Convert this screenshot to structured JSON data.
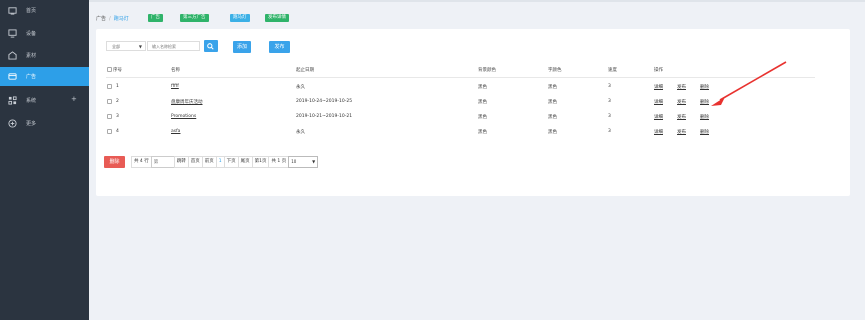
{
  "sidebar": {
    "items": [
      {
        "label": "首页",
        "icon": "home-icon"
      },
      {
        "label": "设备",
        "icon": "monitor-icon"
      },
      {
        "label": "素材",
        "icon": "image-icon"
      },
      {
        "label": "广告",
        "icon": "ad-icon"
      },
      {
        "label": "系统",
        "icon": "grid-icon"
      },
      {
        "label": "更多",
        "icon": "plus-circle-icon"
      }
    ],
    "active_index": 3,
    "accent": "#2d9fe8"
  },
  "breadcrumb": {
    "root": "广告",
    "separator": "/",
    "current": "跑马灯"
  },
  "tabs": [
    "广告",
    "第三方广告",
    "跑马灯",
    "发布详情"
  ],
  "filter": {
    "select_value": "全部",
    "search_placeholder": "输入名称检索",
    "add_label": "添加",
    "publish_label": "发布"
  },
  "table": {
    "headers": [
      "序号",
      "名称",
      "起止日期",
      "背景颜色",
      "字颜色",
      "速度",
      "操作"
    ],
    "rows": [
      {
        "index": "1",
        "name": "fffff",
        "dates": "永久",
        "bg_color": "黑色",
        "font_color": "黑色",
        "speed": "3",
        "actions": [
          "详细",
          "发布",
          "删除"
        ]
      },
      {
        "index": "2",
        "name": "盘康周年庆活动",
        "dates": "2019-10-24~2019-10-25",
        "bg_color": "黑色",
        "font_color": "黑色",
        "speed": "3",
        "actions": [
          "详细",
          "发布",
          "删除"
        ]
      },
      {
        "index": "3",
        "name": "Promotions",
        "dates": "2019-10-21~2019-10-21",
        "bg_color": "黑色",
        "font_color": "黑色",
        "speed": "3",
        "actions": [
          "详细",
          "发布",
          "删除"
        ]
      },
      {
        "index": "4",
        "name": "asfa",
        "dates": "永久",
        "bg_color": "黑色",
        "font_color": "黑色",
        "speed": "3",
        "actions": [
          "详细",
          "发布",
          "删除"
        ]
      }
    ]
  },
  "footer": {
    "delete_label": "删除",
    "total_rows": "共 4 行",
    "jump_placeholder": "第",
    "jump_label": "跳转",
    "first_label": "首页",
    "prev_label": "前页",
    "current_page": "1",
    "next_label": "下页",
    "last_label": "尾页",
    "page_info": "第1页",
    "total_pages": "共 1 页",
    "page_size": "10"
  }
}
